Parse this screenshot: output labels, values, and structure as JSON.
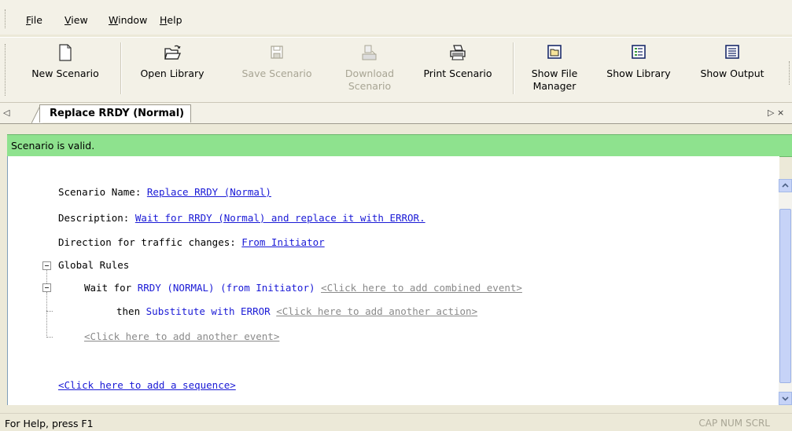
{
  "menu": {
    "file": {
      "underline": "F",
      "rest": "ile"
    },
    "view": {
      "underline": "V",
      "rest": "iew"
    },
    "window": {
      "underline": "W",
      "rest": "indow"
    },
    "help": {
      "underline": "H",
      "rest": "elp"
    }
  },
  "toolbar": {
    "new_scenario": "New Scenario",
    "open_library": "Open Library",
    "save_scenario": "Save Scenario",
    "download_scenario_1": "Download",
    "download_scenario_2": "Scenario",
    "print_scenario": "Print Scenario",
    "show_file_manager_1": "Show File",
    "show_file_manager_2": "Manager",
    "show_library": "Show Library",
    "show_output": "Show Output"
  },
  "tabs": {
    "active": "Replace RRDY (Normal)",
    "nav_left": "◁",
    "nav_right": "▷ ×"
  },
  "validation": "Scenario is valid.",
  "scenario": {
    "name_label": "Scenario Name: ",
    "name_value": "Replace RRDY (Normal)",
    "desc_label": "Description: ",
    "desc_value": "Wait for RRDY (Normal) and replace it with ERROR.",
    "dir_label": "Direction for traffic changes: ",
    "dir_value": "From Initiator",
    "global_rules": "Global Rules",
    "wait_for": "Wait for ",
    "event": "RRDY (NORMAL) (from Initiator)",
    "add_combined": "<Click here to add combined event>",
    "then": "then ",
    "action": "Substitute with ERROR",
    "add_action": "<Click here to add another action>",
    "add_event": "<Click here to add another event>",
    "add_sequence": "<Click here to add a sequence>"
  },
  "status": {
    "help": "For Help, press F1",
    "indicators": "CAP NUM SCRL"
  }
}
